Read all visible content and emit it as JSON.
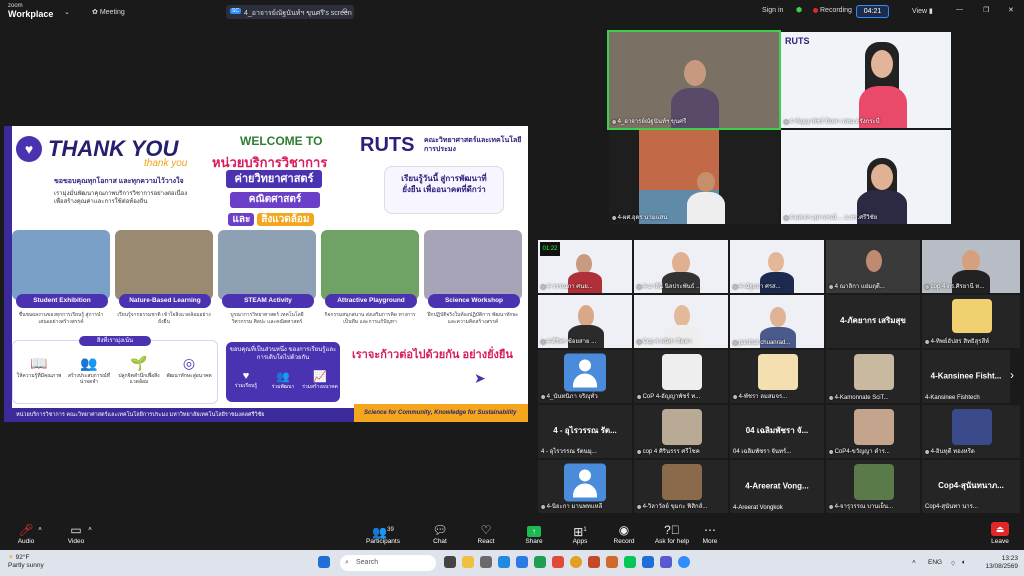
{
  "app": {
    "brand_top": "zoom",
    "brand_bottom": "Workplace",
    "meeting_label": "Meeting",
    "share_tab": "4_อาจารย์ณัฐนันท์ฯ ขุนศรี's screen",
    "sign_in": "Sign in",
    "recording": "Recording",
    "timer": "04:21",
    "view": "View"
  },
  "slide": {
    "thank": "THANK YOU",
    "thank_script": "thank you",
    "line1": "ขอขอบคุณทุกโอกาส และทุกความไว้วางใจ",
    "line2": "เรามุ่งมั่นพัฒนาคุณภาพบริการวิชาการอย่างต่อเนื่อง",
    "line3": "เพื่อสร้างคุณค่าและการใช้ต่อท้องถิ่น",
    "welcome": "WELCOME TO",
    "unit": "หน่วยบริการวิชาการ",
    "camp": "ค่ายวิทยาศาสตร์",
    "sci": "คณิตศาสตร์",
    "and": "และ",
    "env": "สิ่งแวดล้อม",
    "ruts": "RUTS",
    "faculty": "คณะวิทยาศาสตร์และเทคโนโลยีการประมง",
    "quote": "เรียนรู้วันนี้ สู่การพัฒนาที่ยั่งยืน เพื่ออนาคตที่ดีกว่า",
    "activities": [
      {
        "label": "Student Exhibition",
        "desc": "ชื่นชมผลงานของทุกการเรียนรู้ สู่การนำเสนออย่างสร้างสรรค์",
        "color": "#7aa0c8"
      },
      {
        "label": "Nature-Based Learning",
        "desc": "เรียนรู้จากธรรมชาติ เข้าใจสิ่งแวดล้อมอย่างยั่งยืน",
        "color": "#9a8a72"
      },
      {
        "label": "STEAM Activity",
        "desc": "บูรณาการวิทยาศาสตร์ เทคโนโลยี วิศวกรรม ศิลปะ และคณิตศาสตร์",
        "color": "#8ea0b4"
      },
      {
        "label": "Attractive Playground",
        "desc": "กิจกรรมสนุกสนาน ส่งเสริมการคิด ทางการเป็นทีม และการแก้ปัญหา",
        "color": "#6fa264"
      },
      {
        "label": "Science Workshop",
        "desc": "ฝึกปฏิบัติจริงในห้องปฏิบัติการ พัฒนาทักษะและความคิดสร้างสรรค์",
        "color": "#a8a4b8"
      }
    ],
    "focus_title": "สิ่งที่เรามุ่งเน้น",
    "focus": [
      "ให้ความรู้ที่มีคุณภาพ",
      "สร้างประสบการณ์ที่น่าจดจำ",
      "ปลูกจิตสำนึกเพื่อสิ่งแวดล้อม",
      "พัฒนาทักษะสู่อนาคต"
    ],
    "thanks_head": "ขอบคุณที่เป็นส่วนหนึ่ง ของการเรียนรู้และการเติบโตไปด้วยกัน",
    "thanks_items": [
      "ร่วมเรียนรู้",
      "ร่วมพัฒนา",
      "ร่วมสร้างอนาคต"
    ],
    "go": "เราจะก้าวต่อไปด้วยกัน อย่างยั่งยืน",
    "footer_left": "หน่วยบริการวิชาการ คณะวิทยาศาสตร์และเทคโนโลยีการประมง มหาวิทยาลัยเทคโนโลยีราชมงคลศรีวิชัย",
    "footer_right": "Science for Community, Knowledge for Sustainability"
  },
  "top_tiles": [
    "4_อาจารย์ณัฐนันท์ฯ ขุนศรี",
    "4-ชัญญาพัชร์ ปินทา สพม.ตรังกระบี่",
    "4-ผศ.อุดร นามแสน",
    "4-ผศ.ดร.สุภาภรณ์ ... ม.ทร.ศรีวิชัย"
  ],
  "gallery": {
    "row1": [
      "4-วรรณภา ศนย...",
      "4-มาลินี นิลประพันธ์ ...",
      "4-ณัฐธยา ศรส...",
      "4 ณาลิกา แย่มฤดี...",
      "cop 4 ดร.ศิรยานี ห..."
    ],
    "row2": [
      "4-ศิริพร ช้อยสาย ...",
      "Cop 4 ดนิศา จิตตา",
      "panthat chuanrad...",
      "4-ภัคยากร เสริมสุข",
      "4-ทิพย์อัปสร สิทธิสุรสีห์"
    ],
    "row2_big": "4-ภัคยากร เสริมสุข",
    "row3": [
      "4_นันทนิภา จริญุทั่ว",
      "CoP 4-อัญญาพัชร์ ท...",
      "4-พัชรา ลมสมจร...",
      "4-Kamonnate SciT...",
      "4-Kansinee Fishtech"
    ],
    "row3_big": "4-Kansinee Fisht...",
    "row4": [
      "4 - อุไรวรรณ รัตนมุ...",
      "cop 4 ศิรินรรร ศรีโชค",
      "04 เฉลิมพัชรา จันทร์...",
      "CoP4-ขวัญญา ดำร...",
      "4-อินทุดี ทองหรีด"
    ],
    "row4_big": [
      "4 - อุไรวรรณ รัต...",
      "04 เฉลิมพัชรา จั..."
    ],
    "row5": [
      "4-นิยะกา มานพทแหลี",
      "4-วิลาวัลย์ ขุมกะ ฟิสิกส์...",
      "4-Areerat Vongkok",
      "4-จารุวรรณ บานเย็น...",
      "Cop4-สุนันทา นาร..."
    ],
    "row5_big": [
      "4-Areerat Vong...",
      "Cop4-สุนันทนาภ..."
    ]
  },
  "toolbar": {
    "audio": "Audio",
    "video": "Video",
    "participants": "Participants",
    "participants_count": "39",
    "chat": "Chat",
    "react": "React",
    "share": "Share",
    "apps": "Apps",
    "apps_count": "1",
    "record": "Record",
    "help": "Ask for help",
    "more": "More",
    "leave": "Leave"
  },
  "taskbar": {
    "temp": "92°F",
    "weather": "Partly sunny",
    "search": "Search",
    "lang": "ENG",
    "time": "13:23",
    "date": "13/08/2569"
  }
}
